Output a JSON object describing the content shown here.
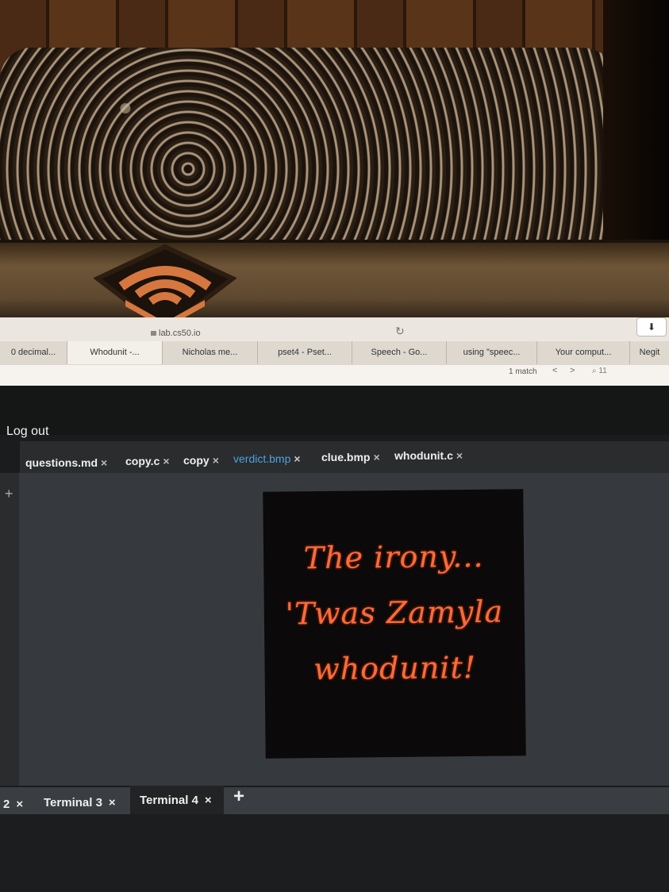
{
  "browser": {
    "url": "lab.cs50.io",
    "tabs": [
      {
        "label": "0 decimal...",
        "active": false
      },
      {
        "label": "Whodunit -...",
        "active": true
      },
      {
        "label": "Nicholas me...",
        "active": false
      },
      {
        "label": "pset4 - Pset...",
        "active": false
      },
      {
        "label": "Speech - Go...",
        "active": false
      },
      {
        "label": "using \"speec...",
        "active": false
      },
      {
        "label": "Your comput...",
        "active": false
      },
      {
        "label": "Negit",
        "active": false
      }
    ],
    "find": {
      "count": "1 match",
      "prev": "<",
      "next": ">",
      "query": "11"
    },
    "download_icon": "download-icon",
    "reload_icon": "reload-icon"
  },
  "ide": {
    "logout_label": "Log out",
    "editor_tabs": [
      {
        "label": "questions.md",
        "active": false
      },
      {
        "label": "copy.c",
        "active": false
      },
      {
        "label": "copy",
        "active": false
      },
      {
        "label": "verdict.bmp",
        "active": true
      },
      {
        "label": "clue.bmp",
        "active": false
      },
      {
        "label": "whodunit.c",
        "active": false
      }
    ],
    "close_glyph": "×",
    "gutter_plus": "+",
    "image": {
      "lines": [
        "The irony...",
        "'Twas Zamyla",
        "whodunit!"
      ],
      "text_color": "#ff6a3a",
      "background": "#0b0909"
    },
    "terminal_tabs": [
      {
        "label": "2",
        "active": false
      },
      {
        "label": "Terminal 3",
        "active": false
      },
      {
        "label": "Terminal 4",
        "active": true
      }
    ],
    "terminal_add": "+"
  },
  "colors": {
    "accent": "#2fa1e0",
    "tab_active_text": "#4aa3df"
  }
}
